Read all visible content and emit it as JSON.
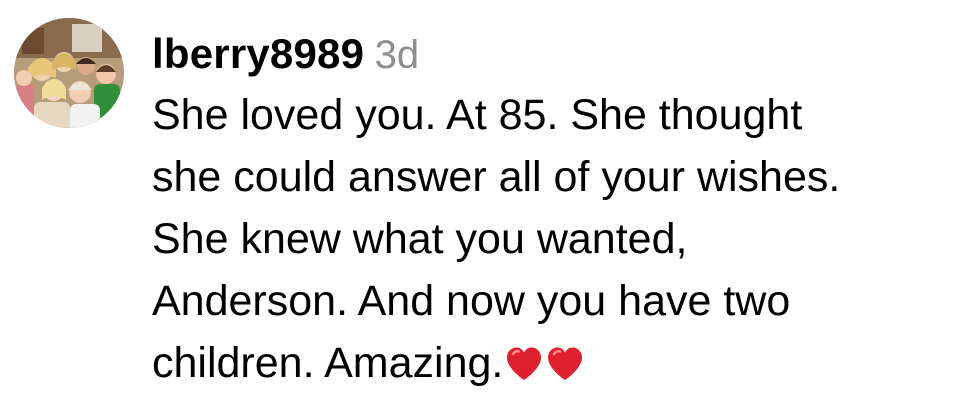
{
  "comment": {
    "username": "lberry8989",
    "timestamp": "3d",
    "lines": [
      "She loved you. At 85. She thought",
      "she could answer all of your wishes.",
      "She knew what you wanted,",
      "Anderson. And now you have two",
      "children. Amazing."
    ],
    "emojis": [
      "red-heart",
      "red-heart"
    ]
  },
  "colors": {
    "timestamp": "#8e8e8e",
    "text": "#000000",
    "heart": "#e0202e"
  }
}
